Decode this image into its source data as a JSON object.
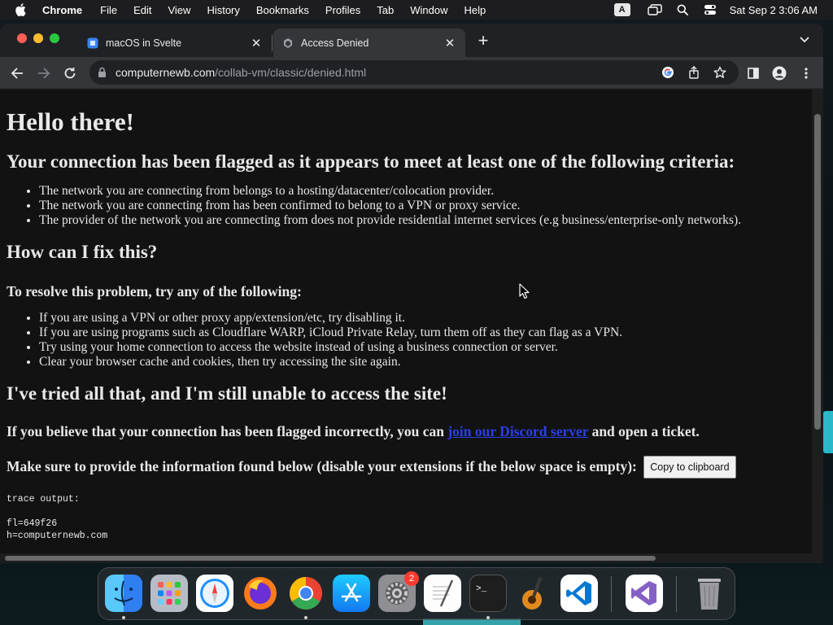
{
  "menubar": {
    "app_name": "Chrome",
    "items": [
      "File",
      "Edit",
      "View",
      "History",
      "Bookmarks",
      "Profiles",
      "Tab",
      "Window",
      "Help"
    ],
    "input_source": "A",
    "clock": "Sat Sep 2  3:06 AM"
  },
  "tabs": [
    {
      "title": "macOS in Svelte",
      "active": false
    },
    {
      "title": "Access Denied",
      "active": true
    }
  ],
  "omnibox": {
    "host": "computernewb.com",
    "path": "/collab-vm/classic/denied.html"
  },
  "page": {
    "h1": "Hello there!",
    "h2_criteria": "Your connection has been flagged as it appears to meet at least one of the following criteria:",
    "criteria": [
      "The network you are connecting from belongs to a hosting/datacenter/colocation provider.",
      "The network you are connecting from has been confirmed to belong to a VPN or proxy service.",
      "The provider of the network you are connecting from does not provide residential internet services (e.g business/enterprise-only networks)."
    ],
    "h2_fix": "How can I fix this?",
    "h3_resolve": "To resolve this problem, try any of the following:",
    "fixes": [
      "If you are using a VPN or other proxy app/extension/etc, try disabling it.",
      "If you are using programs such as Cloudflare WARP, iCloud Private Relay, turn them off as they can flag as a VPN.",
      "Try using your home connection to access the website instead of using a business connection or server.",
      "Clear your browser cache and cookies, then try accessing the site again."
    ],
    "h2_tried": "I've tried all that, and I'm still unable to access the site!",
    "flagged_before": "If you believe that your connection has been flagged incorrectly, you can ",
    "discord_link": "join our Discord server",
    "flagged_after": " and open a ticket.",
    "info_text": "Make sure to provide the information found below (disable your extensions if the below space is empty):",
    "copy_button": "Copy to clipboard",
    "trace_label": "trace output:",
    "trace_lines": [
      "fl=649f26",
      "h=computernewb.com"
    ]
  },
  "dock": {
    "apps": [
      "Finder",
      "Launchpad",
      "Safari",
      "Firefox",
      "Chrome",
      "App Store",
      "System Settings",
      "TextEdit",
      "Terminal",
      "GarageBand",
      "Visual Studio Code",
      "Visual Studio",
      "Trash"
    ],
    "system_settings_badge": "2"
  },
  "colors": {
    "page_bg": "#121212",
    "link": "#2a3fe6",
    "browser_chrome": "#35363a"
  }
}
